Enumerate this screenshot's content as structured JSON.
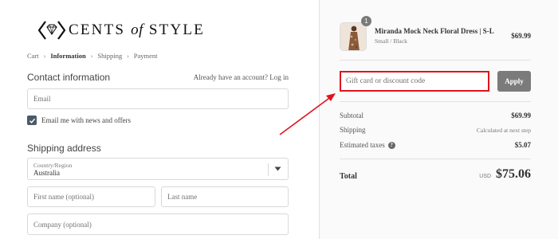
{
  "brand": {
    "logo_text_1": "CENTS",
    "logo_text_of": "of",
    "logo_text_2": "STYLE"
  },
  "breadcrumb": {
    "items": [
      {
        "label": "Cart"
      },
      {
        "label": "Information"
      },
      {
        "label": "Shipping"
      },
      {
        "label": "Payment"
      }
    ],
    "active_index": 1,
    "separator_icon": "chevron-right-icon"
  },
  "contact": {
    "title": "Contact information",
    "login_hint": "Already have an account? Log in",
    "email_placeholder": "Email",
    "newsletter_label": "Email me with news and offers",
    "newsletter_checked": true
  },
  "shipping": {
    "title": "Shipping address",
    "country_label": "Country/Region",
    "country_value": "Australia",
    "first_name_placeholder": "First name (optional)",
    "last_name_placeholder": "Last name",
    "company_placeholder": "Company (optional)"
  },
  "order": {
    "item": {
      "name": "Miranda Mock Neck Floral Dress | S-L",
      "variant": "Small / Black",
      "price": "$69.99",
      "quantity": "1"
    },
    "discount_placeholder": "Gift card or discount code",
    "apply_label": "Apply",
    "subtotal_label": "Subtotal",
    "subtotal_value": "$69.99",
    "shipping_label": "Shipping",
    "shipping_value": "Calculated at next step",
    "taxes_label": "Estimated taxes",
    "taxes_value": "$5.07",
    "total_label": "Total",
    "total_currency": "USD",
    "total_value": "$75.06"
  },
  "colors": {
    "annotation_red": "#e0141e",
    "checkbox": "#4a5a66",
    "apply_button": "#7b7b7b"
  }
}
